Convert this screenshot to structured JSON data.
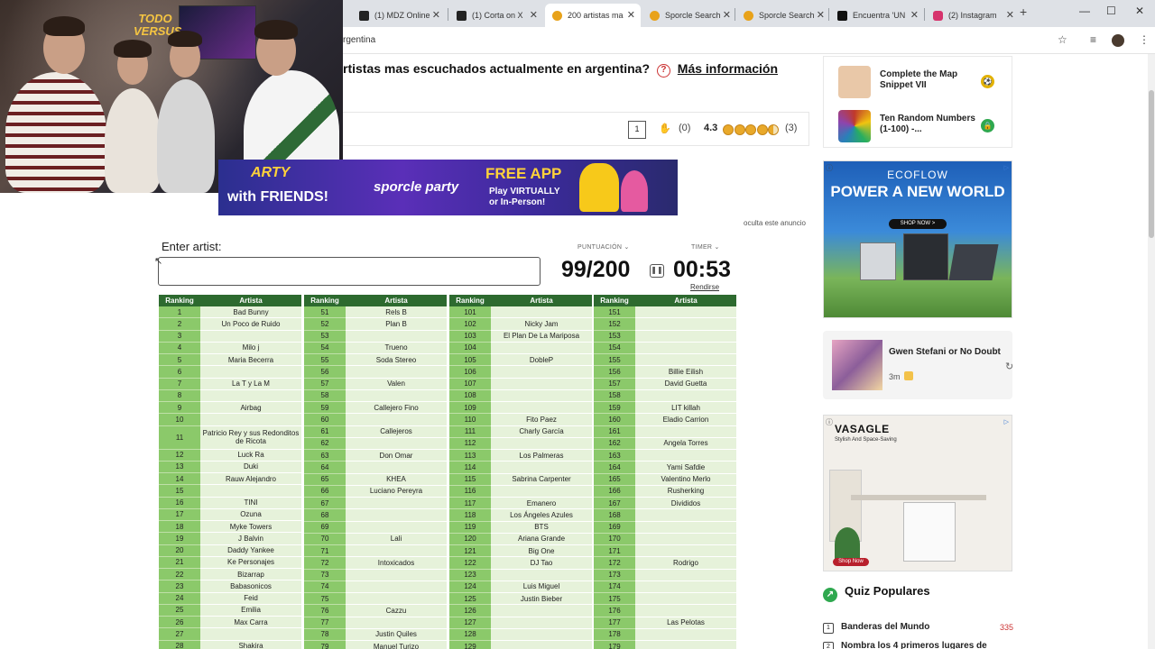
{
  "browser": {
    "tabs": [
      {
        "title": "(1) MDZ Online",
        "fav_color": "#222222",
        "active": false
      },
      {
        "title": "(1) Corta on X",
        "fav_color": "#222222",
        "active": false
      },
      {
        "title": "200 artistas ma",
        "fav_color": "#e8a21a",
        "active": true
      },
      {
        "title": "Sporcle Search",
        "fav_color": "#e8a21a",
        "active": false
      },
      {
        "title": "Sporcle Search",
        "fav_color": "#e8a21a",
        "active": false
      },
      {
        "title": "Encuentra 'UN",
        "fav_color": "#111111",
        "active": false
      },
      {
        "title": "(2) Instagram",
        "fav_color": "#d6336c",
        "active": false
      }
    ],
    "address_fragment": "rgentina",
    "new_tab": "+",
    "window_controls": [
      "⌄",
      "—",
      "☐",
      "✕"
    ]
  },
  "webcam": {
    "overlay_logo": "TODO VERSUS"
  },
  "quiz": {
    "question": "rtistas mas escuchados actualmente en argentina?",
    "help_symbol": "?",
    "more_info": "Más información",
    "comments_count": "1",
    "likes": "(0)",
    "rating": "4.3",
    "rating_count": "(3)",
    "stars_value": 4.3,
    "enter_label": "Enter artist:",
    "input_value": "",
    "score_label": "PUNTUACIÓN",
    "timer_label": "TIMER",
    "score": "99/200",
    "timer": "00:53",
    "give_up": "Rendirse",
    "ad_dismiss": "oculta este anuncio",
    "table_headers": {
      "rank": "Ranking",
      "artist": "Artista"
    },
    "columns": [
      [
        [
          "1",
          "Bad Bunny"
        ],
        [
          "2",
          "Un Poco de Ruido"
        ],
        [
          "3",
          ""
        ],
        [
          "4",
          "Milo j"
        ],
        [
          "5",
          "Maria Becerra"
        ],
        [
          "6",
          ""
        ],
        [
          "7",
          "La T y La M"
        ],
        [
          "8",
          ""
        ],
        [
          "9",
          "Airbag"
        ],
        [
          "10",
          ""
        ],
        [
          "11",
          "Patricio Rey y sus Redonditos de Ricota"
        ],
        [
          "12",
          "Luck Ra"
        ],
        [
          "13",
          "Duki"
        ],
        [
          "14",
          "Rauw Alejandro"
        ],
        [
          "15",
          ""
        ],
        [
          "16",
          "TINI"
        ],
        [
          "17",
          "Ozuna"
        ],
        [
          "18",
          "Myke Towers"
        ],
        [
          "19",
          "J Balvin"
        ],
        [
          "20",
          "Daddy Yankee"
        ],
        [
          "21",
          "Ke Personajes"
        ],
        [
          "22",
          "Bizarrap"
        ],
        [
          "23",
          "Babasonicos"
        ],
        [
          "24",
          "Feid"
        ],
        [
          "25",
          "Emilia"
        ],
        [
          "26",
          "Max Carra"
        ],
        [
          "27",
          ""
        ],
        [
          "28",
          "Shakira"
        ]
      ],
      [
        [
          "51",
          "Rels B"
        ],
        [
          "52",
          "Plan B"
        ],
        [
          "53",
          ""
        ],
        [
          "54",
          "Trueno"
        ],
        [
          "55",
          "Soda Stereo"
        ],
        [
          "56",
          ""
        ],
        [
          "57",
          "Valen"
        ],
        [
          "58",
          ""
        ],
        [
          "59",
          "Callejero Fino"
        ],
        [
          "60",
          ""
        ],
        [
          "61",
          "Callejeros"
        ],
        [
          "62",
          ""
        ],
        [
          "63",
          "Don Omar"
        ],
        [
          "64",
          ""
        ],
        [
          "65",
          "KHEA"
        ],
        [
          "66",
          "Luciano Pereyra"
        ],
        [
          "67",
          ""
        ],
        [
          "68",
          ""
        ],
        [
          "69",
          ""
        ],
        [
          "70",
          "Lali"
        ],
        [
          "71",
          ""
        ],
        [
          "72",
          "Intoxicados"
        ],
        [
          "73",
          ""
        ],
        [
          "74",
          ""
        ],
        [
          "75",
          ""
        ],
        [
          "76",
          "Cazzu"
        ],
        [
          "77",
          ""
        ],
        [
          "78",
          "Justin Quiles"
        ],
        [
          "79",
          "Manuel Turizo"
        ]
      ],
      [
        [
          "101",
          ""
        ],
        [
          "102",
          "Nicky Jam"
        ],
        [
          "103",
          "El Plan De La Mariposa"
        ],
        [
          "104",
          ""
        ],
        [
          "105",
          "DobleP"
        ],
        [
          "106",
          ""
        ],
        [
          "107",
          ""
        ],
        [
          "108",
          ""
        ],
        [
          "109",
          ""
        ],
        [
          "110",
          "Fito Paez"
        ],
        [
          "111",
          "Charly García"
        ],
        [
          "112",
          ""
        ],
        [
          "113",
          "Los Palmeras"
        ],
        [
          "114",
          ""
        ],
        [
          "115",
          "Sabrina Carpenter"
        ],
        [
          "116",
          ""
        ],
        [
          "117",
          "Emanero"
        ],
        [
          "118",
          "Los Ángeles Azules"
        ],
        [
          "119",
          "BTS"
        ],
        [
          "120",
          "Ariana Grande"
        ],
        [
          "121",
          "Big One"
        ],
        [
          "122",
          "DJ Tao"
        ],
        [
          "123",
          ""
        ],
        [
          "124",
          "Luis Miguel"
        ],
        [
          "125",
          "Justin Bieber"
        ],
        [
          "126",
          ""
        ],
        [
          "127",
          ""
        ],
        [
          "128",
          ""
        ],
        [
          "129",
          ""
        ]
      ],
      [
        [
          "151",
          ""
        ],
        [
          "152",
          ""
        ],
        [
          "153",
          ""
        ],
        [
          "154",
          ""
        ],
        [
          "155",
          ""
        ],
        [
          "156",
          "Billie Eilish"
        ],
        [
          "157",
          "David Guetta"
        ],
        [
          "158",
          ""
        ],
        [
          "159",
          "LIT killah"
        ],
        [
          "160",
          "Eladio Carrion"
        ],
        [
          "161",
          ""
        ],
        [
          "162",
          "Angela Torres"
        ],
        [
          "163",
          ""
        ],
        [
          "164",
          "Yami Safdie"
        ],
        [
          "165",
          "Valentino Merlo"
        ],
        [
          "166",
          "Rusherking"
        ],
        [
          "167",
          "Divididos"
        ],
        [
          "168",
          ""
        ],
        [
          "169",
          ""
        ],
        [
          "170",
          ""
        ],
        [
          "171",
          ""
        ],
        [
          "172",
          "Rodrigo"
        ],
        [
          "173",
          ""
        ],
        [
          "174",
          ""
        ],
        [
          "175",
          ""
        ],
        [
          "176",
          ""
        ],
        [
          "177",
          "Las Pelotas"
        ],
        [
          "178",
          ""
        ],
        [
          "179",
          ""
        ]
      ]
    ]
  },
  "banner": {
    "party_text": "ARTY",
    "brand": "sporcle party",
    "free_app": "FREE APP",
    "play_text": "Play VIRTUALLY or In-Person!",
    "friends": "with FRIENDS!"
  },
  "sidebar": {
    "related": [
      {
        "title": "Complete the Map Snippet VII",
        "badge": "⚽",
        "badge_color": "#e2b100",
        "thumb": "#e9c8a8"
      },
      {
        "title": "Ten Random Numbers (1-100) -...",
        "badge": "🔒",
        "badge_color": "#2fa84f",
        "thumb": "#c0392b"
      }
    ],
    "ad_ecoflow": {
      "logo": "ECOFLOW",
      "headline": "POWER A NEW WORLD",
      "cta": "SHOP NOW >"
    },
    "gwen": {
      "title": "Gwen Stefani or No Doubt",
      "time": "3m"
    },
    "ad_vasagle": {
      "logo": "VASAGLE",
      "tagline": "Stylish And Space-Saving",
      "cta": "Shop Now"
    },
    "popular_title": "Quiz Populares",
    "popular": [
      {
        "num": "1",
        "title": "Banderas del Mundo",
        "count": "335"
      },
      {
        "num": "2",
        "title": "Nombra los 4 primeros lugares de",
        "count": ""
      }
    ]
  }
}
